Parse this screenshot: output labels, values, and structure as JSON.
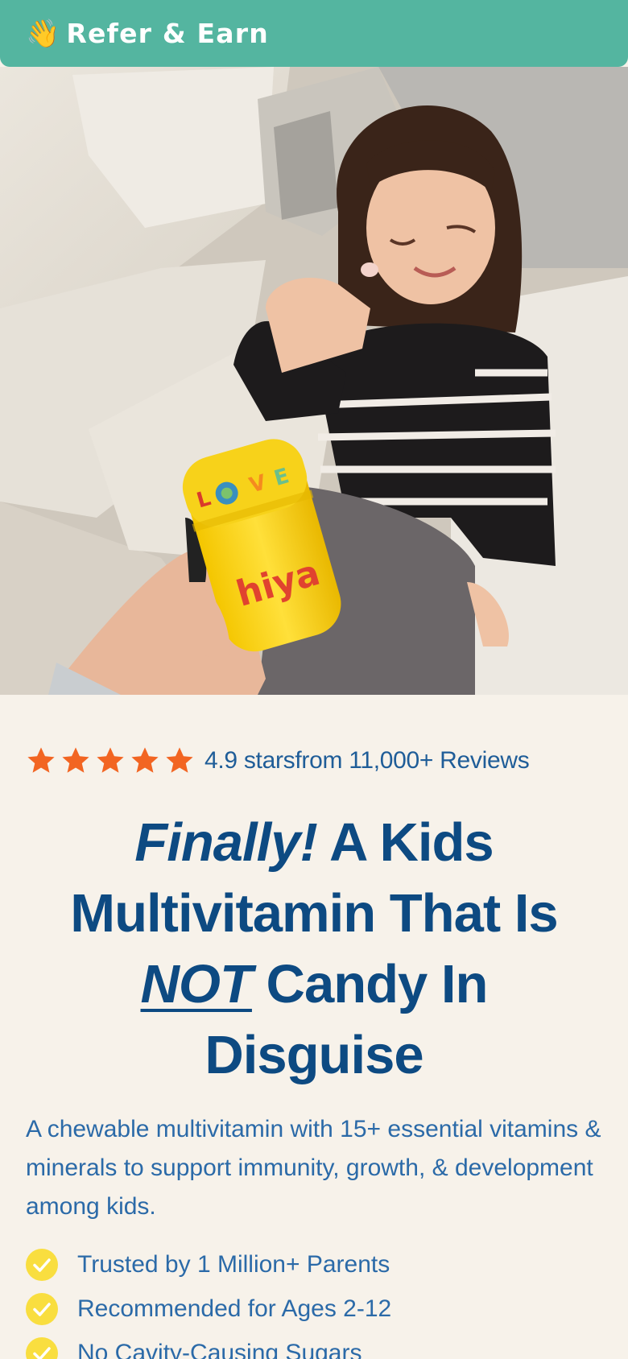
{
  "banner": {
    "icon": "waving-hand-icon",
    "emoji": "👋",
    "label": "Refer & Earn",
    "color": "#54b5a0"
  },
  "hero": {
    "image": "child-holding-chewable-vitamin-photo",
    "bottle_brand": "hiya",
    "bottle_cap_letters": [
      "L",
      "O",
      "V",
      "E"
    ]
  },
  "rating": {
    "star_count": 5,
    "star_color": "#f26522",
    "score_text": "4.9 stars",
    "reviews_text": "from 11,000+ Reviews"
  },
  "headline": {
    "line1_emphasis": "Finally!",
    "line1_rest": " A Kids",
    "line2": "Multivitamin That Is",
    "line3_underlined": "NOT",
    "line3_rest": " Candy In",
    "line4": "Disguise"
  },
  "subtext": "A chewable multivitamin with 15+ essential vitamins & minerals to support immunity, growth, & development among kids.",
  "benefits": [
    {
      "icon": "check-circle-icon",
      "label": "Trusted by 1 Million+ Parents"
    },
    {
      "icon": "check-circle-icon",
      "label": "Recommended for Ages 2-12"
    },
    {
      "icon": "check-circle-icon",
      "label": "No Cavity-Causing Sugars"
    }
  ],
  "colors": {
    "background": "#f7f2ea",
    "headline": "#0d4a82",
    "body_text": "#2b6aa8",
    "check": "#f9de3f"
  }
}
